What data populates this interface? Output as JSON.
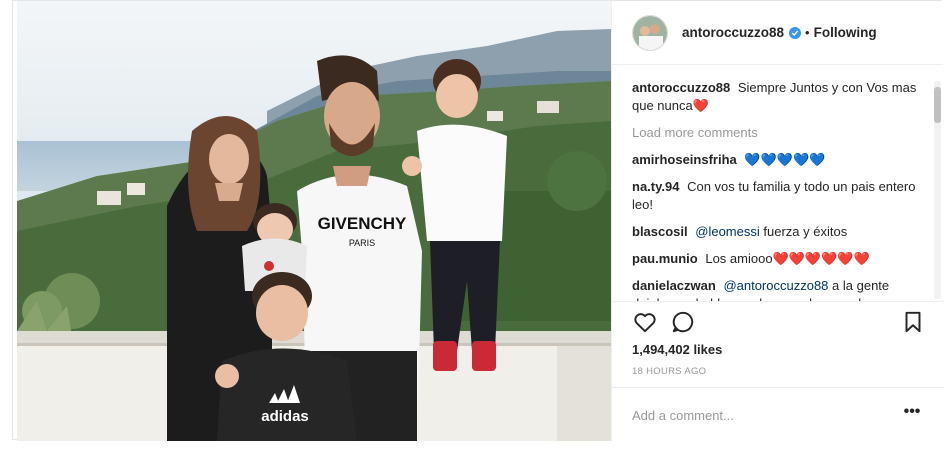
{
  "post": {
    "author": "antoroccuzzo88",
    "follow_state": "Following",
    "separator": "•",
    "shirt_print_top": "GIVENCHY",
    "shirt_print_bottom": "PARIS",
    "kid_shirt_print": "adidas"
  },
  "caption": {
    "user": "antoroccuzzo88",
    "text": "Siempre Juntos y con Vos mas que nunca",
    "emoji": "❤️"
  },
  "load_more": "Load more comments",
  "comments": [
    {
      "user": "amirhoseinsfriha",
      "text": "💙💙💙💙💙"
    },
    {
      "user": "na.ty.94",
      "text": "Con vos tu familia y todo un pais entero leo!"
    },
    {
      "user": "blascosil",
      "mention": "@leomessi",
      "text": "fuerza y éxitos"
    },
    {
      "user": "pau.munio",
      "text": "Los amiooo❤️❤️❤️❤️❤️❤️"
    },
    {
      "user": "danielaczwan",
      "mention": "@antoroccuzzo88",
      "text": "a la gente dejala que hable.... sabes que hay mucha"
    }
  ],
  "likes": "1,494,402 likes",
  "time_ago": "18 HOURS AGO",
  "add_comment": {
    "placeholder": "Add a comment..."
  },
  "more_label": "•••",
  "icons": [
    "heart-icon",
    "comment-icon",
    "bookmark-icon",
    "verified-icon",
    "more-options-icon"
  ],
  "colors": {
    "verified": "#3897f0",
    "link": "#003569",
    "muted": "#999999"
  }
}
